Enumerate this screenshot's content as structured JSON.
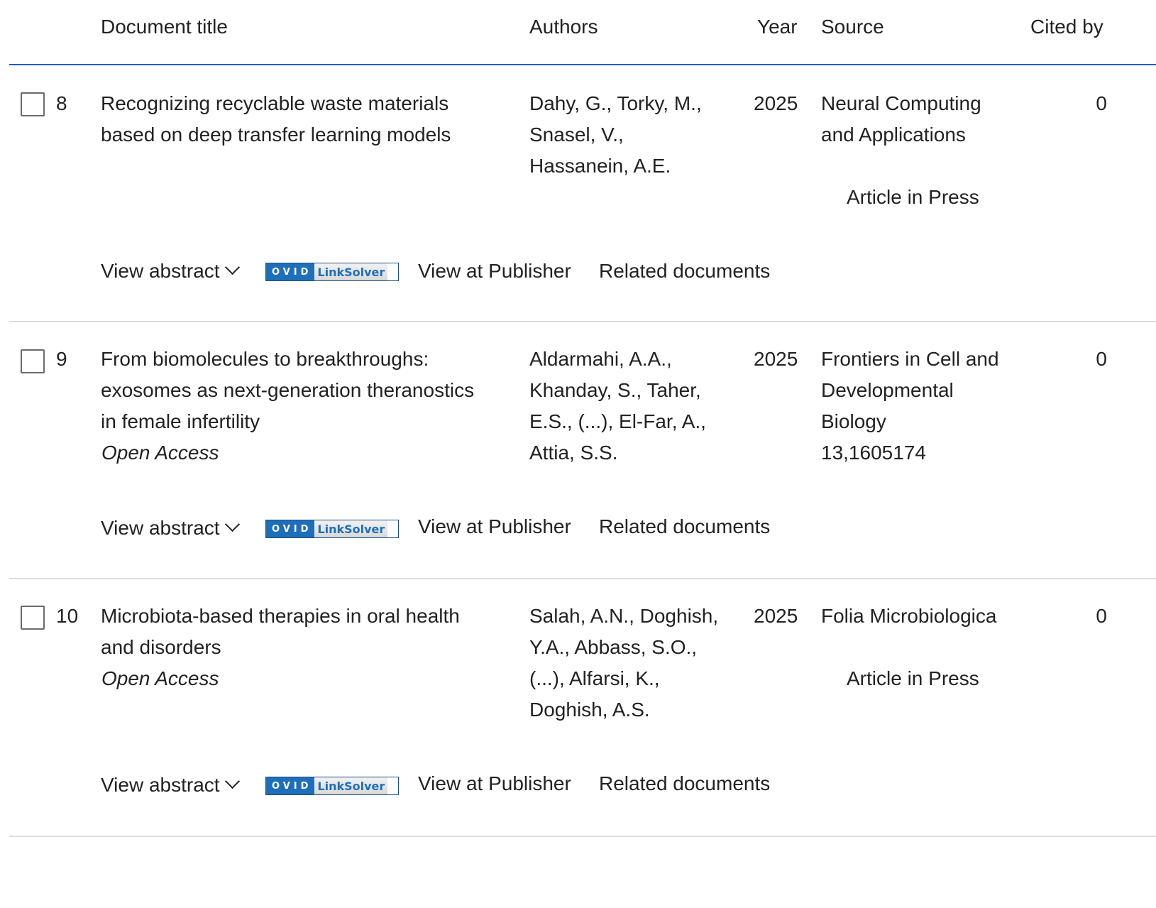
{
  "header": {
    "document_title": "Document title",
    "authors": "Authors",
    "year": "Year",
    "source": "Source",
    "cited_by": "Cited by"
  },
  "actions": {
    "view_abstract": "View abstract",
    "ovid_brand": "OVID",
    "linksolver": "LinkSolver",
    "view_at_publisher": "View at Publisher",
    "related_documents": "Related documents"
  },
  "rows": [
    {
      "index": "8",
      "title_lines": [
        "Recognizing recyclable waste materials",
        "based on deep transfer learning models"
      ],
      "open_access": "",
      "author_lines": [
        "Dahy, G., Torky, M.,",
        "Snasel, V.,",
        "Hassanein, A.E."
      ],
      "year": "2025",
      "source_lines": [
        "Neural Computing",
        "and Applications"
      ],
      "status": "Article in Press",
      "cited_by": "0"
    },
    {
      "index": "9",
      "title_lines": [
        "From biomolecules to breakthroughs:",
        "exosomes as next-generation theranostics",
        "in female infertility"
      ],
      "open_access": "Open Access",
      "author_lines": [
        "Aldarmahi, A.A.,",
        "Khanday, S., Taher,",
        "E.S., (...), El-Far, A.,",
        "Attia, S.S."
      ],
      "year": "2025",
      "source_lines": [
        "Frontiers in Cell and",
        "Developmental",
        "Biology",
        "13,1605174"
      ],
      "status": "",
      "cited_by": "0"
    },
    {
      "index": "10",
      "title_lines": [
        "Microbiota-based therapies in oral health",
        "and disorders"
      ],
      "open_access": "Open Access",
      "author_lines": [
        "Salah, A.N., Doghish,",
        "Y.A., Abbass, S.O.,",
        "(...), Alfarsi, K.,",
        "Doghish, A.S."
      ],
      "year": "2025",
      "source_lines": [
        "Folia Microbiologica"
      ],
      "status": "Article in Press",
      "cited_by": "0"
    }
  ]
}
